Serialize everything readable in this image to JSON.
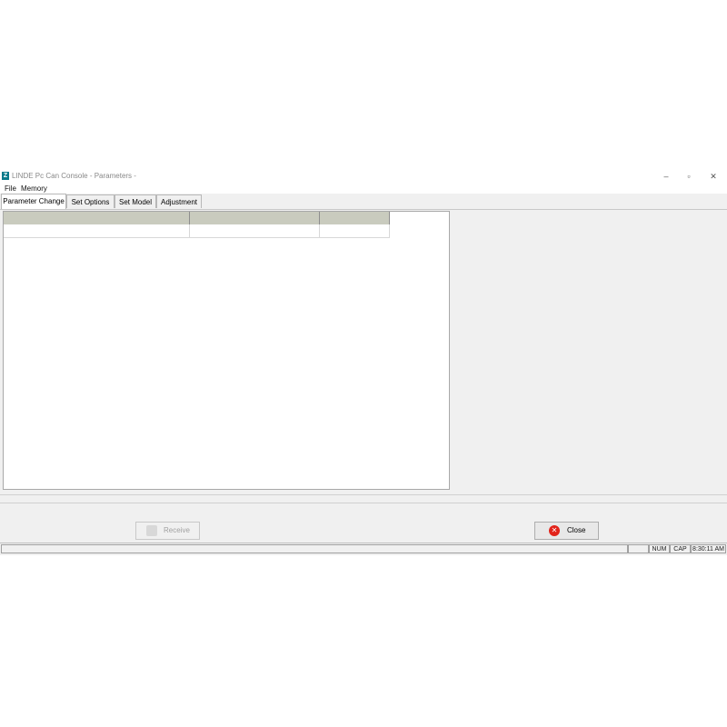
{
  "window": {
    "title": "LINDE Pc Can Console - Parameters -",
    "app_icon_glyph": "Z",
    "controls": {
      "minimize": "–",
      "maximize": "▫",
      "close": "✕"
    }
  },
  "menu": {
    "items": [
      "File",
      "Memory"
    ]
  },
  "tabs": [
    {
      "label": "Parameter Change",
      "active": true
    },
    {
      "label": "Set Options",
      "active": false
    },
    {
      "label": "Set Model",
      "active": false
    },
    {
      "label": "Adjustment",
      "active": false
    }
  ],
  "grid": {
    "header_color": "#c9cbbe"
  },
  "buttons": {
    "receive": {
      "label": "Receive",
      "enabled": false,
      "icon": "receive-icon"
    },
    "close": {
      "label": "Close",
      "enabled": true,
      "icon": "close-red-icon",
      "icon_color": "#e2231a"
    }
  },
  "statusbar": {
    "num": "NUM",
    "cap": "CAP",
    "time": "8:30:11 AM"
  }
}
